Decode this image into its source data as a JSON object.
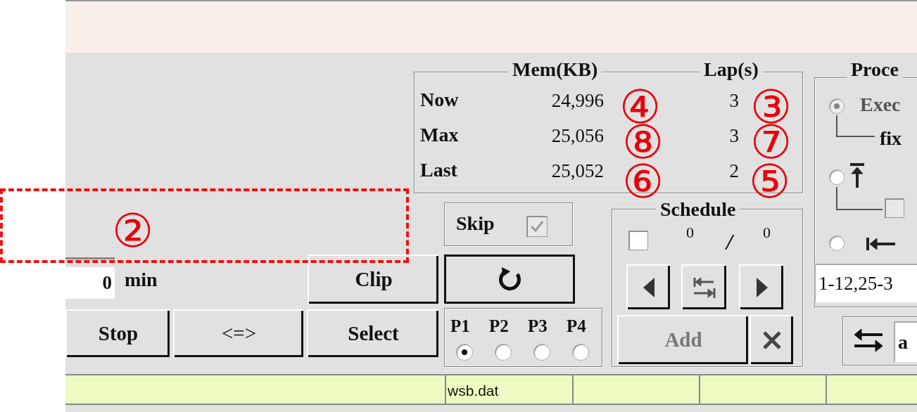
{
  "memory_panel": {
    "mem_legend": "Mem(KB)",
    "lap_legend": "Lap(s)",
    "rows": [
      {
        "label": "Now",
        "mem": "24,996",
        "lap": "3"
      },
      {
        "label": "Max",
        "mem": "25,056",
        "lap": "3"
      },
      {
        "label": "Last",
        "mem": "25,052",
        "lap": "2"
      }
    ]
  },
  "process_panel": {
    "legend": "Proce",
    "options": [
      {
        "kind": "text",
        "label": "Exec",
        "selected": true,
        "disabled": true
      },
      {
        "kind": "top",
        "selected": false,
        "disabled": false
      },
      {
        "kind": "start",
        "selected": false,
        "disabled": false
      }
    ],
    "sub_label": "fix",
    "sub_checked": false,
    "range_value": "1-12,25-3"
  },
  "swap_field": {
    "value": "a"
  },
  "skip": {
    "label": "Skip",
    "checked": true
  },
  "priority": [
    {
      "label": "P1",
      "selected": true
    },
    {
      "label": "P2",
      "selected": false
    },
    {
      "label": "P3",
      "selected": false
    },
    {
      "label": "P4",
      "selected": false
    }
  ],
  "schedule": {
    "legend": "Schedule",
    "checked": false,
    "current": "0",
    "separator": "/",
    "total": "0",
    "add_label": "Add",
    "add_disabled": true
  },
  "timer": {
    "value": "0",
    "unit": "min"
  },
  "clip_button": "Clip",
  "bottom_buttons": [
    "Stop",
    "<=>",
    "Select"
  ],
  "status_bar": {
    "file": "wsb.dat"
  },
  "annotations": [
    {
      "kind": "box"
    },
    {
      "kind": "circle",
      "label": "②"
    },
    {
      "kind": "circle",
      "label": "④"
    },
    {
      "kind": "circle",
      "label": "③"
    },
    {
      "kind": "circle",
      "label": "⑧"
    },
    {
      "kind": "circle",
      "label": "⑦"
    },
    {
      "kind": "circle",
      "label": "⑥"
    },
    {
      "kind": "circle",
      "label": "⑤"
    }
  ]
}
